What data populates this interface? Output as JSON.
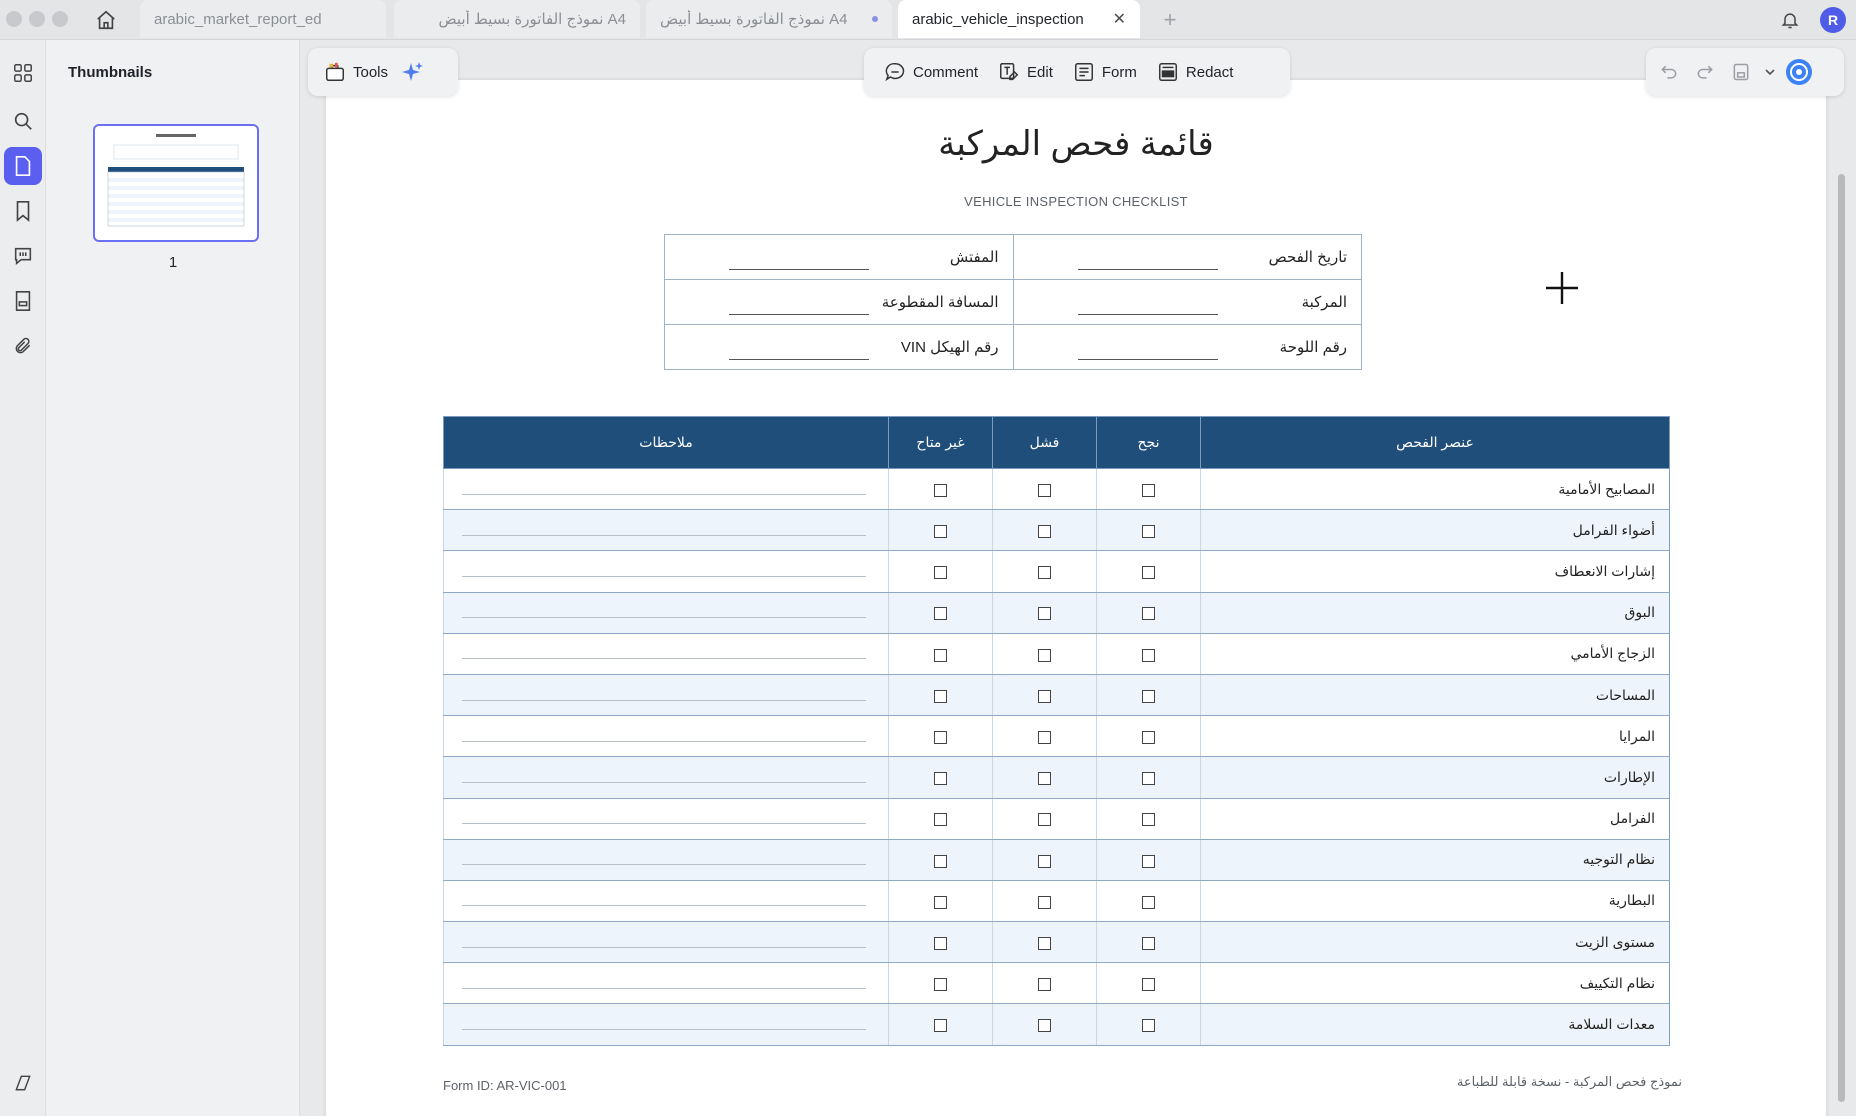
{
  "tabs": [
    {
      "label": "arabic_market_report_ed",
      "active": false,
      "modified": false
    },
    {
      "label": "A4 نموذج الفاتورة بسيط أبيض",
      "active": false,
      "modified": false
    },
    {
      "label": "A4 نموذج الفاتورة بسيط أبيض",
      "active": false,
      "modified": true
    },
    {
      "label": "arabic_vehicle_inspection",
      "active": true,
      "modified": false
    }
  ],
  "user": {
    "initial": "R"
  },
  "sidebar": {
    "title": "Thumbnails",
    "page_number": "1"
  },
  "toolbar": {
    "tools_label": "Tools",
    "comment_label": "Comment",
    "edit_label": "Edit",
    "form_label": "Form",
    "redact_label": "Redact"
  },
  "document": {
    "title": "قائمة فحص المركبة",
    "subtitle": "VEHICLE INSPECTION CHECKLIST",
    "info_fields": [
      [
        "تاريخ الفحص",
        "المفتش"
      ],
      [
        "المركبة",
        "المسافة المقطوعة"
      ],
      [
        "رقم اللوحة",
        "رقم الهيكل VIN"
      ]
    ],
    "columns": {
      "item": "عنصر الفحص",
      "pass": "نجح",
      "fail": "فشل",
      "na": "غير متاح",
      "notes": "ملاحظات"
    },
    "items": [
      "المصابيح الأمامية",
      "أضواء الفرامل",
      "إشارات الانعطاف",
      "البوق",
      "الزجاج الأمامي",
      "المساحات",
      "المرايا",
      "الإطارات",
      "الفرامل",
      "نظام التوجيه",
      "البطارية",
      "مستوى الزيت",
      "نظام التكييف",
      "معدات السلامة"
    ],
    "form_id": "Form ID: AR-VIC-001",
    "footer_note": "نموذج فحص المركبة - نسخة قابلة للطباعة"
  },
  "colors": {
    "accent": "#5b5ff0",
    "table_header": "#1f4e7a",
    "avatar": "#4f5ce8"
  }
}
